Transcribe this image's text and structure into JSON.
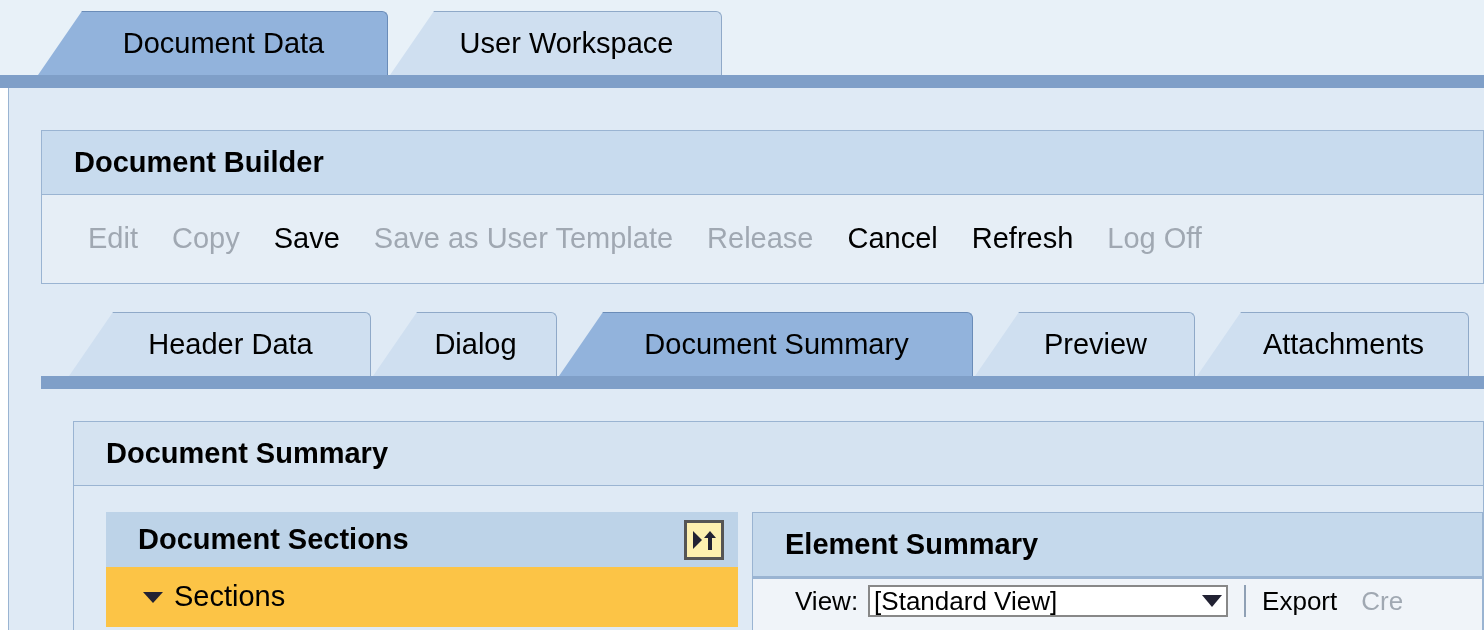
{
  "main_tabs": [
    {
      "label": "Document Data",
      "selected": true
    },
    {
      "label": "User Workspace",
      "selected": false
    }
  ],
  "builder": {
    "title": "Document Builder",
    "toolbar": [
      {
        "label": "Edit",
        "disabled": true
      },
      {
        "label": "Copy",
        "disabled": true
      },
      {
        "label": "Save",
        "disabled": false
      },
      {
        "label": "Save as User Template",
        "disabled": true
      },
      {
        "label": "Release",
        "disabled": true
      },
      {
        "label": "Cancel",
        "disabled": false
      },
      {
        "label": "Refresh",
        "disabled": false
      },
      {
        "label": "Log Off",
        "disabled": true
      }
    ],
    "tabs": [
      {
        "label": "Header Data",
        "selected": false
      },
      {
        "label": "Dialog",
        "selected": false
      },
      {
        "label": "Document Summary",
        "selected": true
      },
      {
        "label": "Preview",
        "selected": false
      },
      {
        "label": "Attachments",
        "selected": false
      }
    ]
  },
  "summary": {
    "title": "Document Summary",
    "sections": {
      "title": "Document Sections",
      "items": [
        {
          "label": "Sections",
          "expanded": true,
          "selected": true
        }
      ]
    },
    "elements": {
      "title": "Element Summary",
      "view_label": "View:",
      "view_value": "[Standard View]",
      "actions": [
        {
          "label": "Export",
          "disabled": false
        },
        {
          "label": "Cre",
          "disabled": true
        }
      ]
    }
  }
}
